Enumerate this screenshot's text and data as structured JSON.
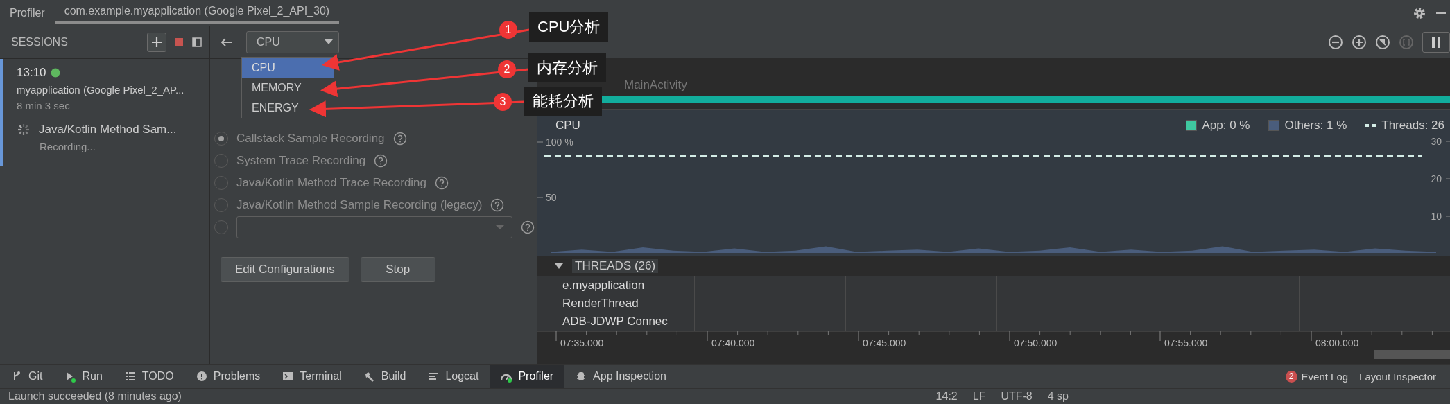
{
  "window": {
    "tabs": [
      {
        "label": "Profiler",
        "selected": false
      },
      {
        "label": "com.example.myapplication (Google Pixel_2_API_30)",
        "selected": true
      }
    ]
  },
  "sessions": {
    "title": "SESSIONS",
    "items": [
      {
        "time": "13:10",
        "live": true,
        "name": "myapplication (Google Pixel_2_AP...",
        "duration": "8 min 3 sec",
        "selected": true,
        "recording": {
          "title": "Java/Kotlin Method Sam...",
          "status": "Recording..."
        }
      }
    ]
  },
  "profiler_select": {
    "value": "CPU",
    "options": [
      {
        "label": "CPU",
        "selected": true
      },
      {
        "label": "MEMORY",
        "selected": false
      },
      {
        "label": "ENERGY",
        "selected": false
      }
    ]
  },
  "recording_options": [
    {
      "kind": "radio",
      "label": "Callstack Sample Recording",
      "selected": true,
      "disabled": true
    },
    {
      "kind": "radio",
      "label": "System Trace Recording",
      "selected": false,
      "disabled": true
    },
    {
      "kind": "radio",
      "label": "Java/Kotlin Method Trace Recording",
      "selected": false,
      "disabled": true
    },
    {
      "kind": "radio",
      "label": "Java/Kotlin Method Sample Recording (legacy)",
      "selected": false,
      "disabled": true
    },
    {
      "kind": "combo",
      "selected": false,
      "disabled": true
    }
  ],
  "buttons": [
    "Edit Configurations",
    "Stop"
  ],
  "activity": {
    "label": "MainActivity"
  },
  "cpu": {
    "title": "CPU",
    "legend": [
      {
        "kind": "swatch",
        "label": "App: 0 %",
        "color": "#3fc8a0"
      },
      {
        "kind": "swatch",
        "label": "Others: 1 %",
        "color": "#4a5d7c"
      },
      {
        "kind": "dash",
        "label": "Threads: 26",
        "color": "#d4ece6"
      }
    ],
    "left_ticks": [
      "100 %",
      "50"
    ],
    "right_ticks": [
      "30",
      "20",
      "10"
    ]
  },
  "threads": {
    "title": "THREADS (26)",
    "expanded": true,
    "items": [
      "e.myapplication",
      "RenderThread",
      "ADB-JDWP Connec"
    ]
  },
  "time_axis": [
    "07:35.000",
    "07:40.000",
    "07:45.000",
    "07:50.000",
    "07:55.000",
    "08:00.000"
  ],
  "annotations": [
    {
      "number": "1",
      "label": "CPU分析"
    },
    {
      "number": "2",
      "label": "内存分析"
    },
    {
      "number": "3",
      "label": "能耗分析"
    }
  ],
  "tool_windows": [
    {
      "label": "Git",
      "selected": false,
      "running": false
    },
    {
      "label": "Run",
      "selected": false,
      "running": true
    },
    {
      "label": "TODO",
      "selected": false,
      "running": false
    },
    {
      "label": "Problems",
      "selected": false,
      "running": false
    },
    {
      "label": "Terminal",
      "selected": false,
      "running": false
    },
    {
      "label": "Build",
      "selected": false,
      "running": false
    },
    {
      "label": "Logcat",
      "selected": false,
      "running": false
    },
    {
      "label": "Profiler",
      "selected": true,
      "running": true
    },
    {
      "label": "App Inspection",
      "selected": false,
      "running": false
    }
  ],
  "tool_windows_right": [
    {
      "label": "Event Log",
      "badge": "2"
    },
    {
      "label": "Layout Inspector"
    }
  ],
  "status_bar": {
    "message": "Launch succeeded (8 minutes ago)",
    "items": [
      "14:2",
      "LF",
      "UTF-8",
      "4 sp"
    ]
  }
}
